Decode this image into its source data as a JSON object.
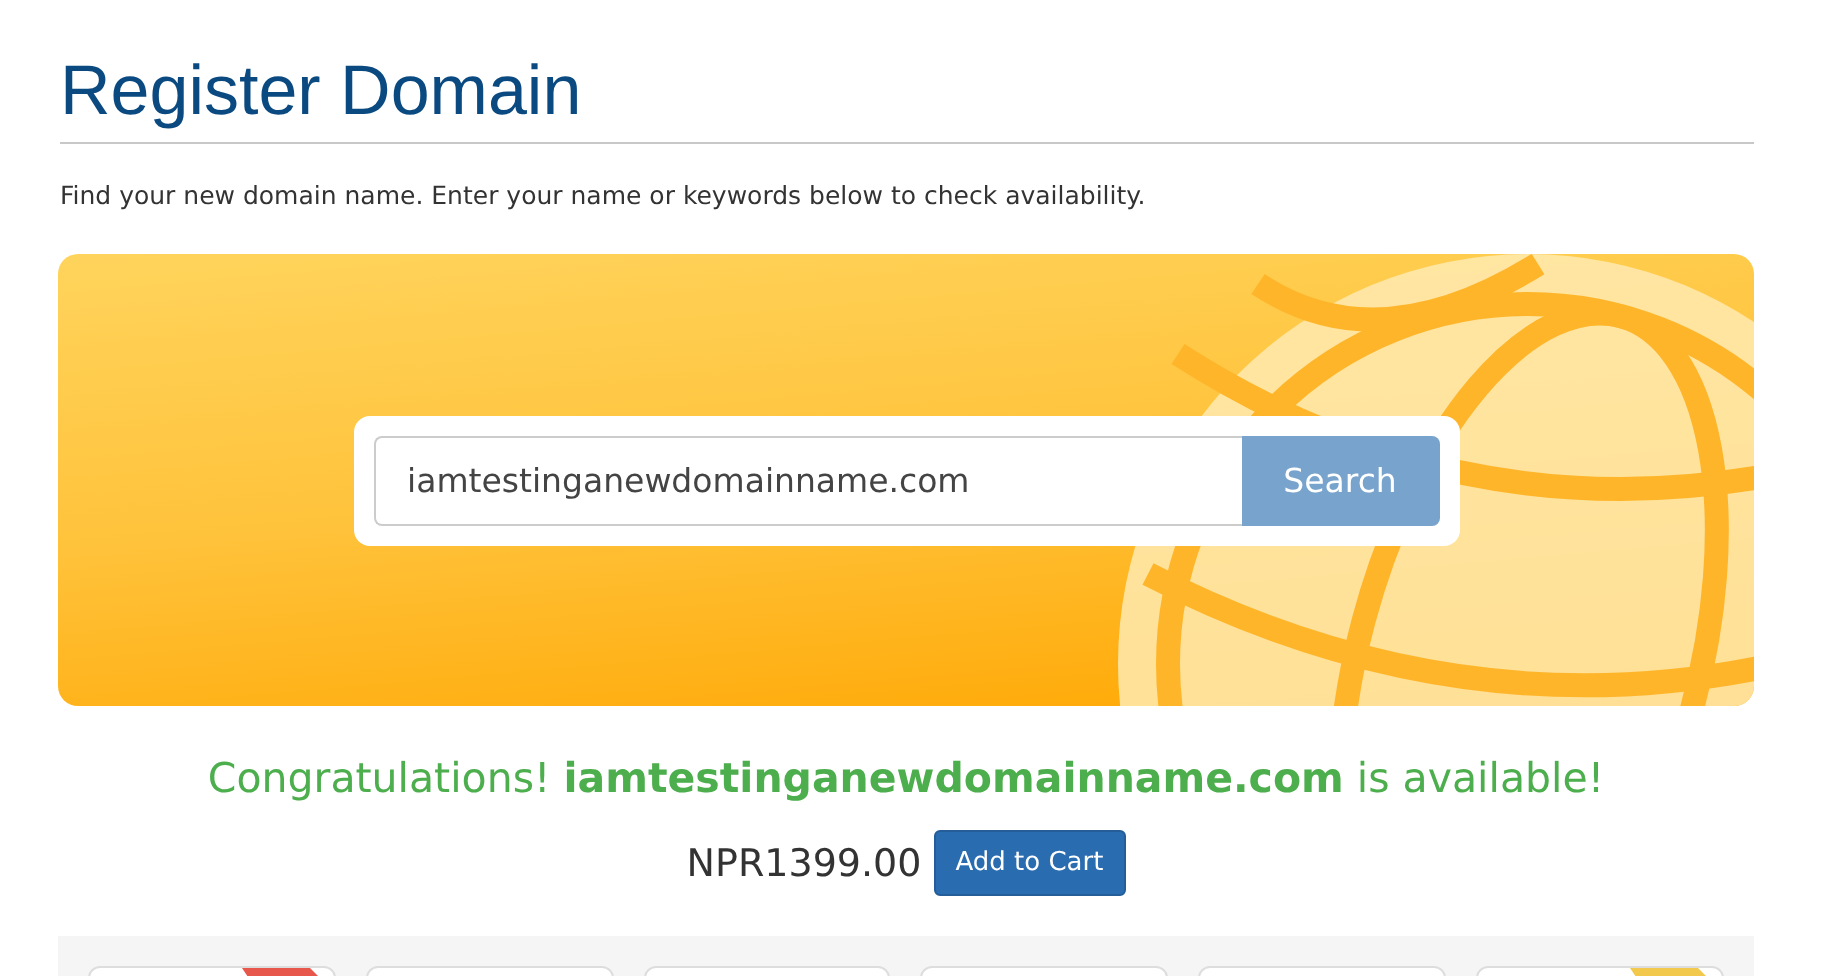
{
  "page": {
    "title": "Register Domain",
    "intro": "Find your new domain name. Enter your name or keywords below to check availability."
  },
  "search": {
    "value": "iamtestinganewdomainname.com",
    "button": "Search"
  },
  "result": {
    "message": "Congratulations! **iamtestinganewdomainname.com** is available!",
    "price": "NPR1399.00",
    "button": "Add to Cart"
  },
  "cards": [
    {
      "kind": "ribbon",
      "color": "#e8574b"
    },
    {
      "kind": "plain"
    },
    {
      "kind": "plain"
    },
    {
      "kind": "plain"
    },
    {
      "kind": "plain"
    },
    {
      "kind": "ribbon",
      "color": "#f2c94c"
    }
  ]
}
